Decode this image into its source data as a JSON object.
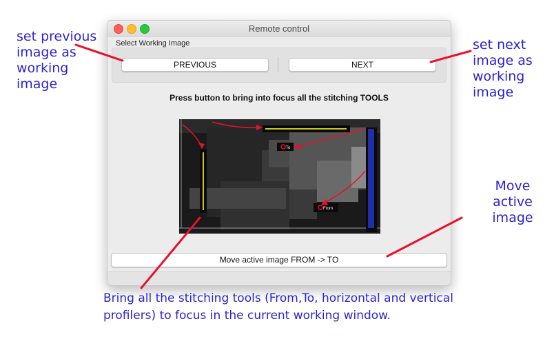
{
  "window": {
    "title": "Remote control",
    "group_label": "Select Working Image",
    "buttons": {
      "previous": "PREVIOUS",
      "next": "NEXT",
      "move": "Move active image FROM -> TO"
    },
    "instruction": "Press button to bring into focus all the stitching TOOLS",
    "preview": {
      "marker_from": "From",
      "marker_to": "To"
    }
  },
  "annotations": {
    "previous": "set previous\nimage as\nworking\nimage",
    "next": "set next\nimage as\nworking\nimage",
    "move": "Move\nactive\nimage",
    "focus": "Bring all the stitching tools (From,To, horizontal and vertical profilers) to focus in the current working window."
  },
  "colors": {
    "annotation_text": "#2d23cf",
    "arrow": "#e8102a",
    "profiler_line": "#c8c81e",
    "vertical_profiler_fill": "#1f2fa8"
  }
}
